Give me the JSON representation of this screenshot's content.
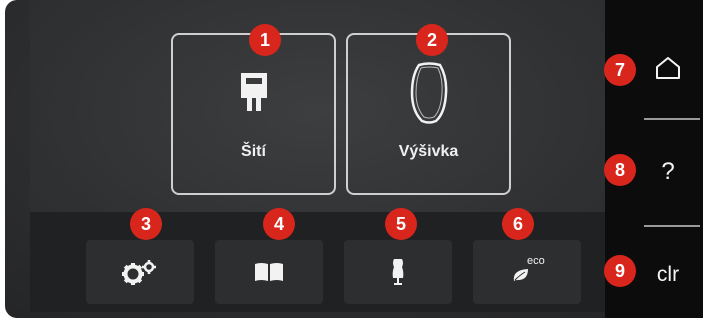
{
  "tiles": {
    "sewing": {
      "label": "Šití",
      "icon": "presser-foot-icon"
    },
    "embroidery": {
      "label": "Výšivka",
      "icon": "embroidery-hoop-icon"
    }
  },
  "bottom_bar": [
    {
      "icon": "gears-icon"
    },
    {
      "icon": "book-icon"
    },
    {
      "icon": "dress-form-icon"
    },
    {
      "icon": "eco-leaf-icon",
      "text": "eco"
    }
  ],
  "sidebar": {
    "home": {
      "icon": "home-icon"
    },
    "help": {
      "icon": "help-icon",
      "text": "?"
    },
    "clear": {
      "icon": "clear-icon",
      "text": "clr"
    }
  },
  "callouts": [
    "1",
    "2",
    "3",
    "4",
    "5",
    "6",
    "7",
    "8",
    "9"
  ],
  "colors": {
    "badge": "#d9261c",
    "background": "#2c2d2f",
    "sidebar": "#0c0c0d",
    "tile_border": "#cfcfcf"
  }
}
